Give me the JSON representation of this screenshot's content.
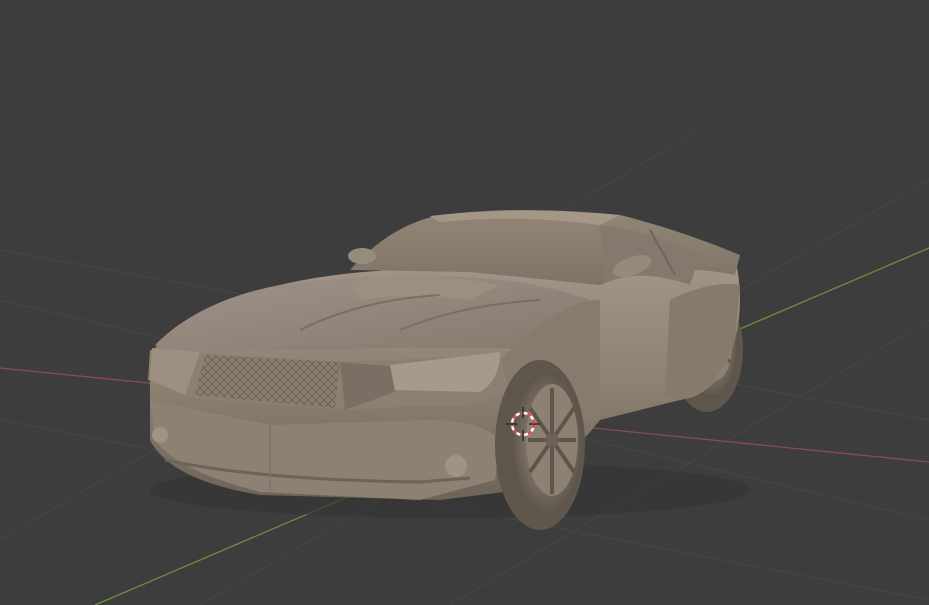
{
  "viewport": {
    "background": "#3d3d3d",
    "grid_line_color": "#474747",
    "x_axis_color": "#8a4b52",
    "y_axis_color": "#6b8f3a"
  },
  "model": {
    "body_color": "#8f8273",
    "body_shadow": "#6f6458",
    "body_highlight": "#a89a8a",
    "tire_color": "#5f564c"
  },
  "origin_marker": {
    "ring_colors": [
      "#e04545",
      "#ffffff"
    ],
    "crosshair_color": "#222222"
  }
}
